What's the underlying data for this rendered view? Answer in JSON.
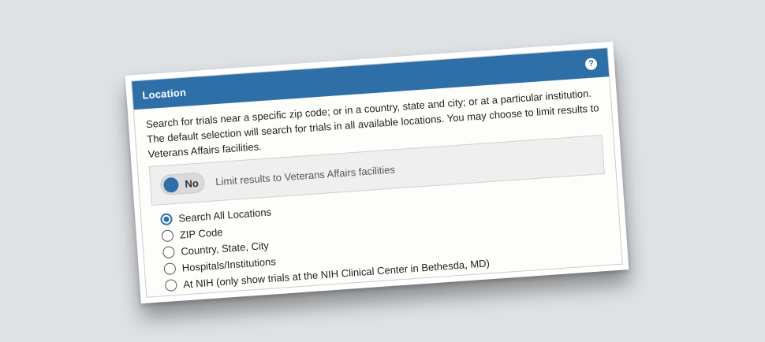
{
  "panel": {
    "title": "Location",
    "help_label": "?",
    "description": "Search for trials near a specific zip code; or in a country, state and city; or at a particular institution. The default selection will search for trials in all available locations. You may choose to limit results to Veterans Affairs facilities.",
    "accent_color": "#2f6fa7"
  },
  "va_filter": {
    "toggle_state_label": "No",
    "label": "Limit results to Veterans Affairs facilities"
  },
  "location_options": [
    {
      "label": "Search All Locations",
      "selected": true
    },
    {
      "label": "ZIP Code",
      "selected": false
    },
    {
      "label": "Country, State, City",
      "selected": false
    },
    {
      "label": "Hospitals/Institutions",
      "selected": false
    },
    {
      "label": "At NIH (only show trials at the NIH Clinical Center in Bethesda, MD)",
      "selected": false
    }
  ]
}
